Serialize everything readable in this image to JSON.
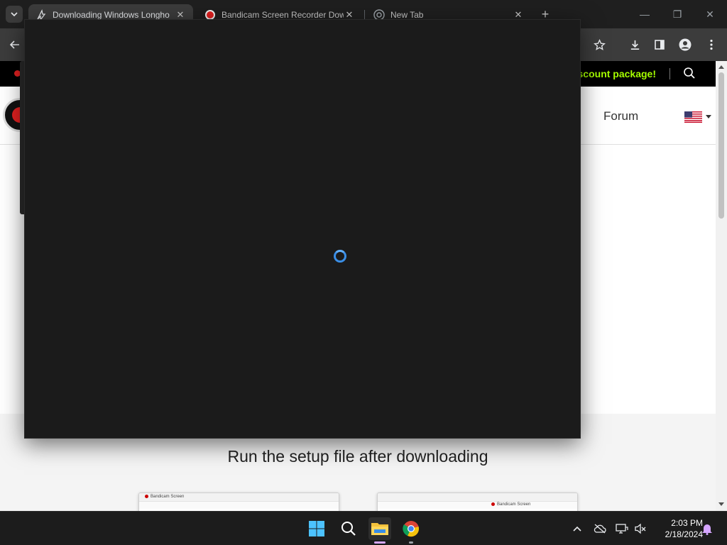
{
  "browser": {
    "tabs": [
      {
        "title": "Downloading Windows Longho",
        "active": true,
        "icon": "bolt-icon"
      },
      {
        "title": "Bandicam Screen Recorder Dow",
        "active": false,
        "icon": "bandicam-icon"
      },
      {
        "title": "New Tab",
        "active": false,
        "icon": "chrome-icon"
      }
    ],
    "new_tab_glyph": "+",
    "window_controls": {
      "minimize": "—",
      "restore": "❐",
      "close": "✕"
    }
  },
  "webpage": {
    "promo_text": "iscount package!",
    "nav_forum": "Forum",
    "setup_heading": "Run the setup file after downloading",
    "thumbnails": [
      {
        "tab_label": "Bandicam Screen"
      },
      {
        "tab_label": "Bandicam Screen"
      }
    ]
  },
  "overlay": {
    "state": "loading",
    "spinner_color": "#3a8ee6"
  },
  "taskbar": {
    "pinned": [
      "windows-start-icon",
      "search-icon",
      "file-explorer-icon",
      "chrome-icon"
    ],
    "clock_time": "2:03 PM",
    "clock_date": "2/18/2024"
  },
  "colors": {
    "promo_accent": "#a6ff00",
    "brand_red": "#e02020",
    "chrome_dark": "#3c3c3c"
  }
}
